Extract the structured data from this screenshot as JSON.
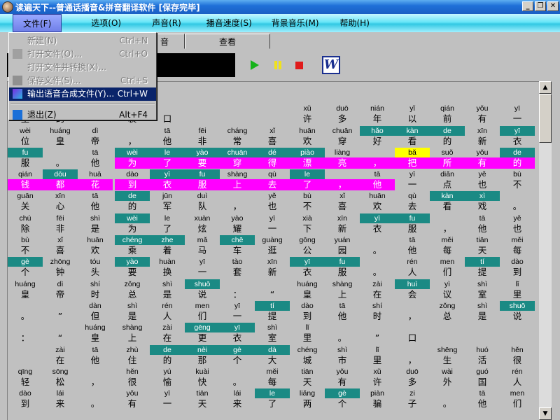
{
  "window": {
    "title": "读遍天下--普通话播音&拼音翻译软件 [保存完毕]"
  },
  "menubar": [
    {
      "label": "文件(F)"
    },
    {
      "label": "选项(O)"
    },
    {
      "label": "声音(R)"
    },
    {
      "label": "播音速度(S)"
    },
    {
      "label": "背景音乐(M)"
    },
    {
      "label": "帮助(H)"
    }
  ],
  "tabs": [
    {
      "label": "音"
    },
    {
      "label": "查看"
    }
  ],
  "toolbar": {
    "lcd_text": "tā"
  },
  "file_menu": [
    {
      "label": "新建(N)",
      "shortcut": "Ctrl+N",
      "enabled": false
    },
    {
      "label": "打开文件(O)...",
      "shortcut": "Ctrl+O",
      "enabled": false
    },
    {
      "label": "打开文件并转换(X)...",
      "shortcut": "",
      "enabled": false
    },
    {
      "label": "保存文件(S)...",
      "shortcut": "Ctrl+S",
      "enabled": false
    },
    {
      "label": "输出语音合成文件(Y)...",
      "shortcut": "Ctrl+W",
      "enabled": true,
      "highlighted": true
    },
    {
      "label": "退出(Z)",
      "shortcut": "Alt+F4",
      "enabled": true
    }
  ],
  "colors": {
    "teal": "#1b8a84",
    "magenta": "#ff00ff",
    "yellow": "#ffff00"
  },
  "grid": [
    [
      "",
      "",
      "",
      "",
      "",
      "",
      "",
      "",
      "",
      "",
      "",
      "",
      "",
      "",
      ""
    ],
    [
      "huáng|皇",
      "dì|的",
      "",
      "zhuāng|装",
      "|口",
      "",
      "",
      "",
      "xǔ|许",
      "duō|多",
      "nián|年",
      "yǐ|以",
      "qián|前",
      "yǒu|有",
      "yī|一"
    ],
    [
      "wèi|位",
      "huáng|皇",
      "dì|帝",
      "|，",
      "tā|他",
      "fēi|非",
      "cháng|常",
      "xǐ|喜",
      "huān|欢",
      "chuān|穿",
      "hǎo*t|好",
      "kàn*t|看",
      "de*t|的",
      "xīn|新",
      "yī*t|衣"
    ],
    [
      "fu*t|服",
      "|。",
      "tā|他",
      "wèi*t|为*m",
      "le*t|了*m",
      "yào*t|要*m",
      "chuān*t|穿*m",
      "dé*t|得*m",
      "piào*t|漂*m",
      "liàng|亮*m",
      "|，*m",
      "bǎ*y|把*m",
      "suǒ|所*m",
      "yǒu|有*m",
      "de*t|的*m"
    ],
    [
      "qián|钱*m",
      "dōu*t|都*m",
      "huā|花*m",
      "dào|到*m",
      "yī*t|衣*m",
      "fu*t|服*m",
      "shàng|上*m",
      "qù|去*m",
      "le*t|了*m",
      "|，*m",
      "tā|他*m",
      "yī|一",
      "diǎn|点",
      "yě|也",
      "bù|不"
    ],
    [
      "guān|关",
      "xīn|心",
      "tā|他",
      "de*t|的",
      "jūn|军",
      "duì|队",
      "|，",
      "yě|也",
      "bù|不",
      "xǐ|喜",
      "huān|欢",
      "qù|去",
      "kàn*t|看",
      "xì*t|戏",
      "|。"
    ],
    [
      "chú|除",
      "fēi|非",
      "shì|是",
      "wèi*t|为",
      "le|了",
      "xuàn|炫",
      "yào|耀",
      "yī|一",
      "xià|下",
      "xīn|新",
      "yī*t|衣",
      "fu*t|服",
      "|，",
      "tā|他",
      "yě|也"
    ],
    [
      "bù|不",
      "xǐ|喜",
      "huān|欢",
      "chéng*t|乘",
      "zhe*t|着",
      "mǎ|马",
      "chē*t|车",
      "guàng|逛",
      "gōng|公",
      "yuán|园",
      "|。",
      "tā|他",
      "měi|每",
      "tiān|天",
      "měi|每"
    ],
    [
      "gè*t|个",
      "zhōng|钟",
      "tóu|头",
      "yào*t|要",
      "huàn|换",
      "yī|一",
      "tào|套",
      "xīn|新",
      "yī*t|衣",
      "fu*t|服",
      "|。",
      "rén|人",
      "men|们",
      "tí*t|提",
      "dào|到"
    ],
    [
      "huáng|皇",
      "dì|帝",
      "shí|时",
      "zǒng|总",
      "shì|是",
      "shuō*t|说",
      "|：",
      "|“",
      "huáng|皇",
      "shàng|上",
      "zài|在",
      "huì*t|会",
      "yì|议",
      "shì|室",
      "lǐ|里"
    ],
    [
      "|。",
      "|”",
      "dàn|但",
      "shì|是",
      "rén|人",
      "men|们",
      "yī|一",
      "tí*t|提",
      "dào|到",
      "tā|他",
      "shí|时",
      "|，",
      "zǒng|总",
      "shì|是",
      "shuō*t|说"
    ],
    [
      "|：",
      "|“",
      "huáng|皇",
      "shàng|上",
      "zài|在",
      "gēng*t|更",
      "yī*t|衣",
      "shì|室",
      "lǐ|里",
      "|。",
      "|”",
      "|口",
      "",
      "",
      ""
    ],
    [
      "",
      "zài|在",
      "tā|他",
      "zhù|住",
      "de*t|的",
      "nèi*t|那",
      "gè*t|个",
      "dà*t|大",
      "chéng|城",
      "shì|市",
      "lǐ|里",
      "|，",
      "shēng|生",
      "huó|活",
      "hěn|很"
    ],
    [
      "qīng|轻",
      "sōng|松",
      "|，",
      "hěn|很",
      "yú|愉",
      "kuài|快",
      "|。",
      "měi|每",
      "tiān|天",
      "yǒu|有",
      "xǔ|许",
      "duō|多",
      "wài|外",
      "guó|国",
      "rén|人"
    ],
    [
      "dào|到",
      "lái|来",
      "|。",
      "yǒu|有",
      "yī|一",
      "tiān|天",
      "lái|来",
      "le*t|了",
      "liǎng|两",
      "gè*t|个",
      "piàn|骗",
      "zi|子",
      "|。",
      "tā|他",
      "men|们"
    ]
  ]
}
